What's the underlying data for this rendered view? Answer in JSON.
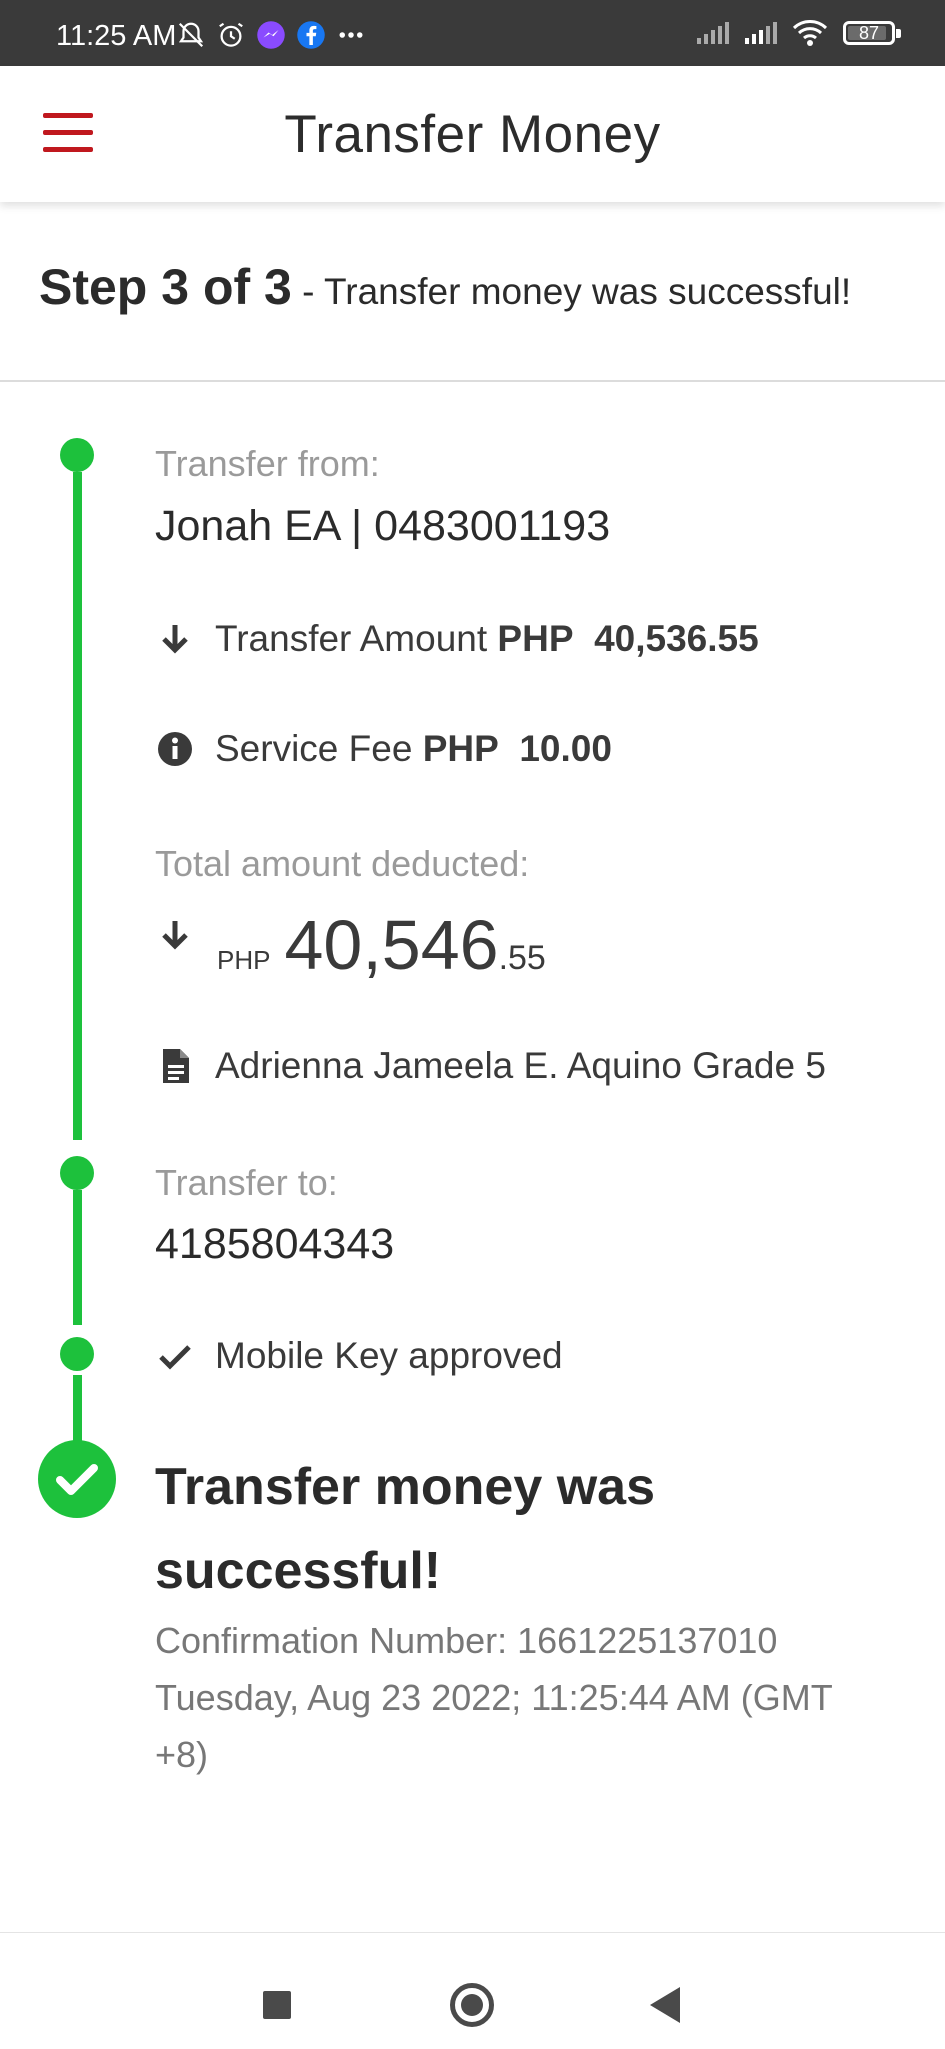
{
  "status_bar": {
    "time": "11:25 AM",
    "battery": "87",
    "icons": [
      "bell-off-icon",
      "alarm-icon",
      "messenger-icon",
      "facebook-icon",
      "more-icon",
      "signal-icon",
      "signal-icon",
      "wifi-icon",
      "battery-icon"
    ]
  },
  "header": {
    "title": "Transfer Money",
    "accent_color": "#c0181e"
  },
  "step": {
    "label": "Step 3 of 3",
    "message": " - Transfer money was successful!"
  },
  "transfer_from": {
    "label": "Transfer from:",
    "value": "Jonah EA | 0483001193"
  },
  "transfer_amount": {
    "label": "Transfer Amount",
    "currency": "PHP",
    "amount": "40,536.55"
  },
  "service_fee": {
    "label": "Service Fee",
    "currency": "PHP",
    "amount": "10.00"
  },
  "total": {
    "label": "Total amount deducted:",
    "currency": "PHP",
    "amount_main": "40,546",
    "amount_cents": ".55"
  },
  "note": "Adrienna Jameela E. Aquino Grade 5",
  "transfer_to": {
    "label": "Transfer to:",
    "value": "4185804343"
  },
  "approval": "Mobile Key approved",
  "success": {
    "title": "Transfer money was successful!",
    "confirmation_label": "Confirmation Number:",
    "confirmation_number": "1661225137010",
    "timestamp": "Tuesday, Aug 23 2022; 11:25:44 AM (GMT +8)"
  },
  "colors": {
    "timeline_green": "#1dc13c"
  }
}
